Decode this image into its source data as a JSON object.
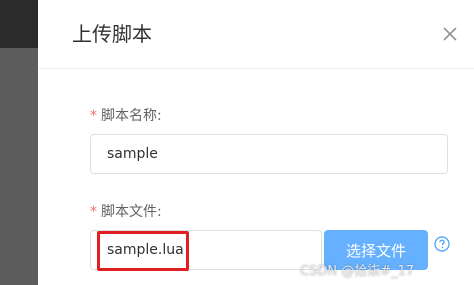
{
  "dialog": {
    "title": "上传脚本",
    "close_icon": "close-icon"
  },
  "form": {
    "required_mark": "*",
    "name_label": "脚本名称:",
    "name_value": "sample",
    "file_label": "脚本文件:",
    "file_value": "sample.lua",
    "select_button_label": "选择文件",
    "help_icon": "question-circle-icon"
  },
  "watermark": "CSDN @拾柒#_17",
  "colors": {
    "primary_button": "#66b1ff",
    "required": "#f56c6c",
    "highlight_box": "#e02020",
    "backdrop": "#5c5c5c"
  }
}
